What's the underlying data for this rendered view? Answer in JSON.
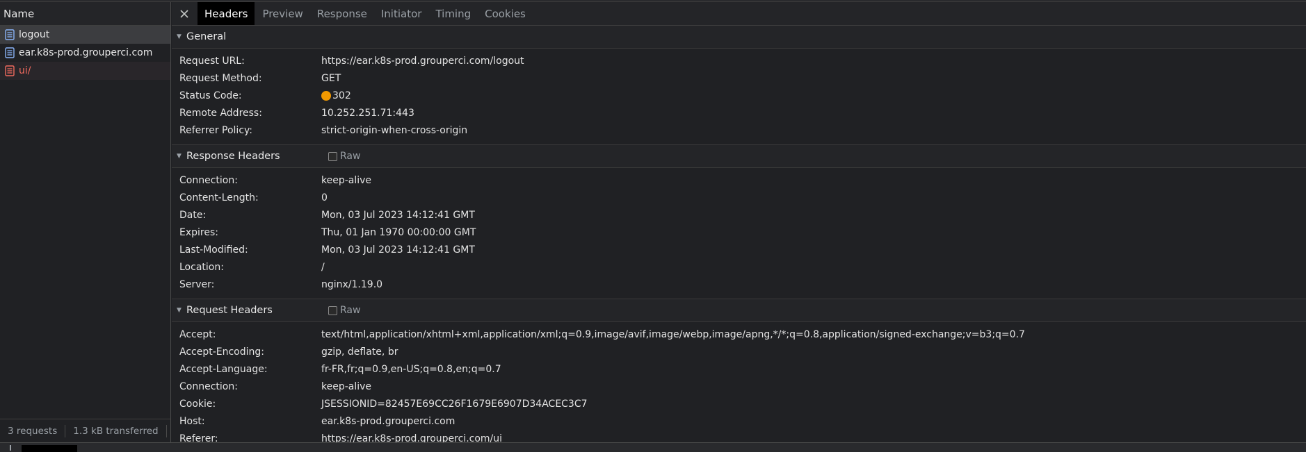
{
  "left_panel": {
    "header": "Name",
    "requests": [
      {
        "name": "logout",
        "state": "selected",
        "icon": "document-icon"
      },
      {
        "name": "ear.k8s-prod.grouperci.com",
        "state": "normal",
        "icon": "document-icon"
      },
      {
        "name": "ui/",
        "state": "error",
        "icon": "document-icon"
      }
    ],
    "status": {
      "requests": "3 requests",
      "transferred": "1.3 kB transferred"
    }
  },
  "tabs": [
    "Headers",
    "Preview",
    "Response",
    "Initiator",
    "Timing",
    "Cookies"
  ],
  "active_tab": "Headers",
  "general": {
    "title": "General",
    "rows": [
      {
        "k": "Request URL:",
        "v": "https://ear.k8s-prod.grouperci.com/logout"
      },
      {
        "k": "Request Method:",
        "v": "GET"
      },
      {
        "k": "Status Code:",
        "v": "302"
      },
      {
        "k": "Remote Address:",
        "v": "10.252.251.71:443"
      },
      {
        "k": "Referrer Policy:",
        "v": "strict-origin-when-cross-origin"
      }
    ]
  },
  "response_headers": {
    "title": "Response Headers",
    "raw_label": "Raw",
    "rows": [
      {
        "k": "Connection:",
        "v": "keep-alive"
      },
      {
        "k": "Content-Length:",
        "v": "0"
      },
      {
        "k": "Date:",
        "v": "Mon, 03 Jul 2023 14:12:41 GMT"
      },
      {
        "k": "Expires:",
        "v": "Thu, 01 Jan 1970 00:00:00 GMT"
      },
      {
        "k": "Last-Modified:",
        "v": "Mon, 03 Jul 2023 14:12:41 GMT"
      },
      {
        "k": "Location:",
        "v": "/"
      },
      {
        "k": "Server:",
        "v": "nginx/1.19.0"
      }
    ]
  },
  "request_headers": {
    "title": "Request Headers",
    "raw_label": "Raw",
    "rows": [
      {
        "k": "Accept:",
        "v": "text/html,application/xhtml+xml,application/xml;q=0.9,image/avif,image/webp,image/apng,*/*;q=0.8,application/signed-exchange;v=b3;q=0.7"
      },
      {
        "k": "Accept-Encoding:",
        "v": "gzip, deflate, br"
      },
      {
        "k": "Accept-Language:",
        "v": "fr-FR,fr;q=0.9,en-US;q=0.8,en;q=0.7"
      },
      {
        "k": "Connection:",
        "v": "keep-alive"
      },
      {
        "k": "Cookie:",
        "v": "JSESSIONID=82457E69CC26F1679E6907D34ACEC3C7"
      },
      {
        "k": "Host:",
        "v": "ear.k8s-prod.grouperci.com"
      },
      {
        "k": "Referer:",
        "v": "https://ear.k8s-prod.grouperci.com/ui"
      }
    ]
  },
  "colors": {
    "status_dot": "#f29900",
    "error_text": "#f16a5e",
    "doc_icon": "#8ab4f8",
    "doc_icon_error": "#f16a5e"
  }
}
